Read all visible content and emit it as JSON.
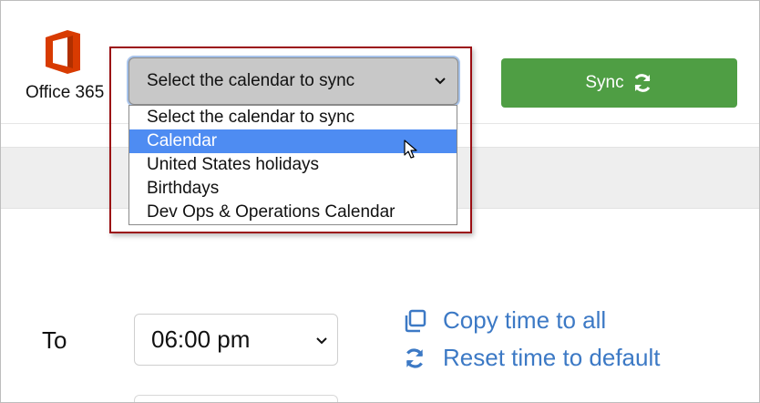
{
  "header": {
    "logo_label": "Office 365"
  },
  "calendar_select": {
    "selected_value": "Select the calendar to sync",
    "options": [
      "Select the calendar to sync",
      "Calendar",
      "United States holidays",
      "Birthdays",
      "Dev Ops & Operations Calendar"
    ],
    "highlighted_option": "Calendar"
  },
  "sync_button": {
    "label": "Sync",
    "icon": "refresh-icon"
  },
  "time_row": {
    "to_label": "To",
    "time_value": "06:00 pm",
    "copy_link": "Copy time to all",
    "reset_link": "Reset time to default"
  },
  "colors": {
    "brand_office": "#d83b01",
    "sync_green": "#4f9e44",
    "link_blue": "#3c79c5",
    "selection_blue": "#4e8cf2",
    "highlight_red": "#9b0e13"
  }
}
